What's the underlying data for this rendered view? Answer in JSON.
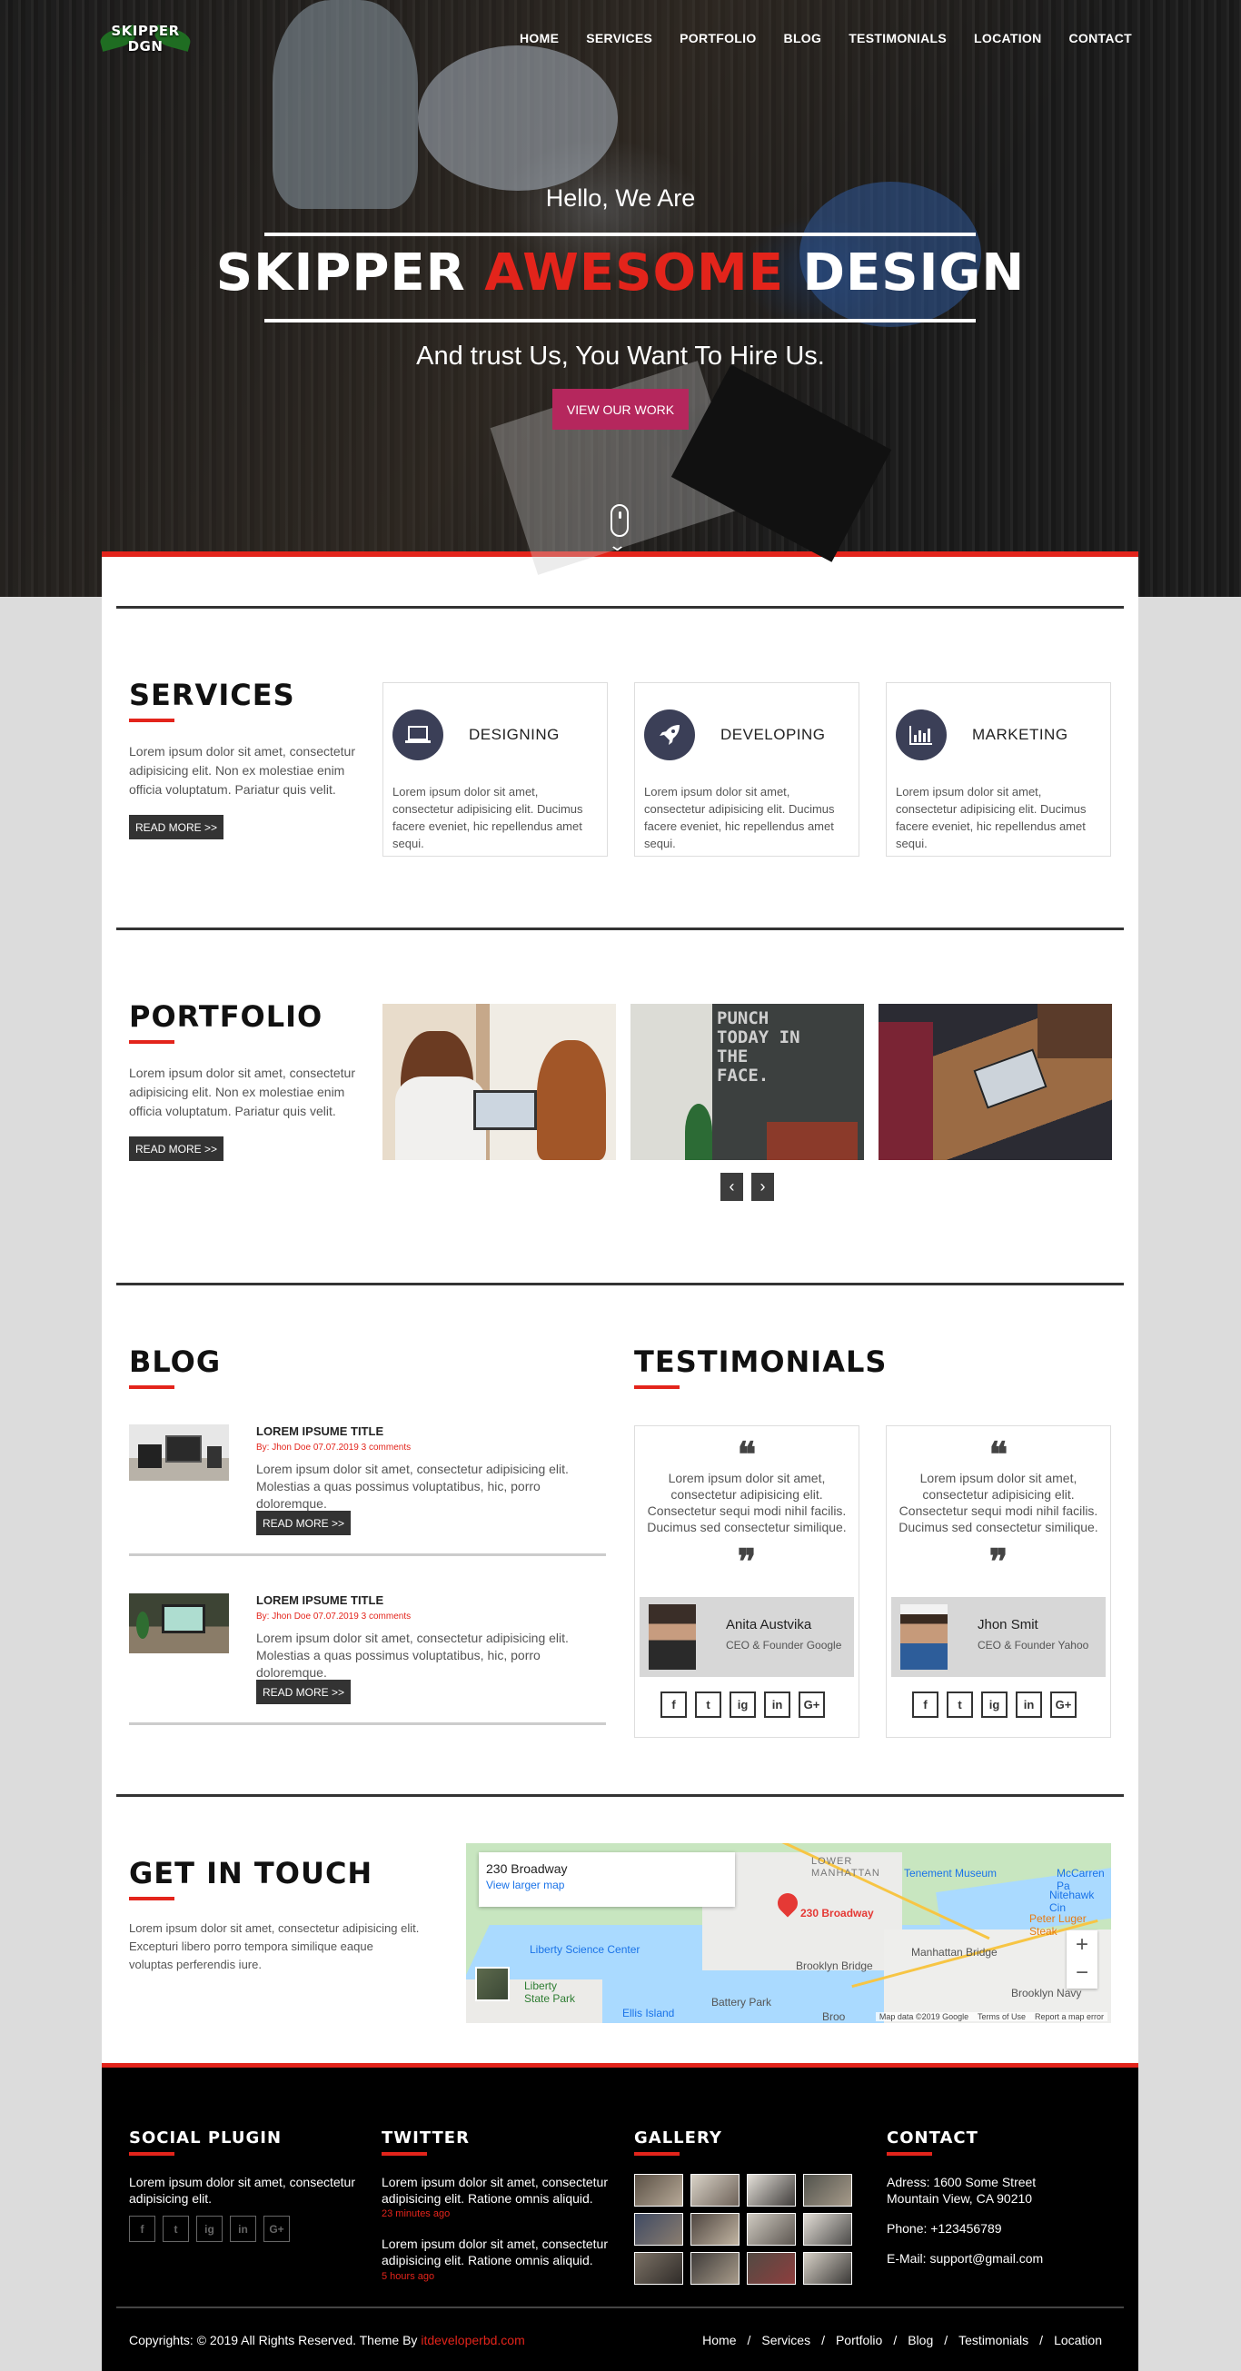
{
  "brand": {
    "logo_line1": "SKIPPER",
    "logo_line2": "DGN"
  },
  "nav": [
    "HOME",
    "SERVICES",
    "PORTFOLIO",
    "BLOG",
    "TESTIMONIALS",
    "LOCATION",
    "CONTACT"
  ],
  "hero": {
    "greeting": "Hello, We Are",
    "headline_a": "SKIPPER ",
    "headline_b": "AWESOME",
    "headline_c": " DESIGN",
    "tagline": "And trust Us, You Want To Hire Us.",
    "cta": "VIEW OUR WORK"
  },
  "services": {
    "title": "SERVICES",
    "text": "Lorem ipsum dolor sit amet, consectetur adipisicing elit. Non ex molestiae enim officia voluptatum. Pariatur quis velit.",
    "button": "READ MORE >>",
    "cards": [
      {
        "name": "DESIGNING",
        "icon": "laptop-icon",
        "text": "Lorem ipsum dolor sit amet, consectetur adipisicing elit. Ducimus facere eveniet, hic repellendus amet sequi."
      },
      {
        "name": "DEVELOPING",
        "icon": "rocket-icon",
        "text": "Lorem ipsum dolor sit amet, consectetur adipisicing elit. Ducimus facere eveniet, hic repellendus amet sequi."
      },
      {
        "name": "MARKETING",
        "icon": "bar-chart-icon",
        "text": "Lorem ipsum dolor sit amet, consectetur adipisicing elit. Ducimus facere eveniet, hic repellendus amet sequi."
      }
    ]
  },
  "portfolio": {
    "title": "PORTFOLIO",
    "text": "Lorem ipsum dolor sit amet, consectetur adipisicing elit. Non ex molestiae enim officia voluptatum. Pariatur quis velit.",
    "button": "READ MORE >>",
    "prev": "‹",
    "next": "›",
    "wall_text": "PUNCH TODAY IN THE FACE."
  },
  "blog": {
    "title": "BLOG",
    "posts": [
      {
        "title": "LOREM IPSUME TITLE",
        "meta": "By: Jhon Doe 07.07.2019 3 comments",
        "text": "Lorem ipsum dolor sit amet, consectetur adipisicing elit. Molestias a quas possimus voluptatibus, hic, porro doloremque.",
        "button": "READ MORE >>"
      },
      {
        "title": "LOREM IPSUME TITLE",
        "meta": "By: Jhon Doe 07.07.2019 3 comments",
        "text": "Lorem ipsum dolor sit amet, consectetur adipisicing elit. Molestias a quas possimus voluptatibus, hic, porro doloremque.",
        "button": "READ MORE >>"
      }
    ]
  },
  "testimonials": {
    "title": "TESTIMONIALS",
    "quote_open": "❝",
    "quote_close": "❞",
    "items": [
      {
        "text": "Lorem ipsum dolor sit amet, consectetur adipisicing elit. Consectetur sequi modi nihil facilis. Ducimus sed consectetur similique.",
        "name": "Anita Austvika",
        "role": "CEO & Founder Google"
      },
      {
        "text": "Lorem ipsum dolor sit amet, consectetur adipisicing elit. Consectetur sequi modi nihil facilis. Ducimus sed consectetur similique.",
        "name": "Jhon Smit",
        "role": "CEO & Founder Yahoo"
      }
    ],
    "social": [
      "f",
      "t",
      "ig",
      "in",
      "G+"
    ]
  },
  "contact_section": {
    "title": "GET IN TOUCH",
    "text": "Lorem ipsum dolor sit amet, consectetur adipisicing elit. Excepturi libero porro tempora similique eaque voluptas perferendis iure.",
    "map": {
      "address": "230 Broadway",
      "larger": "View larger map",
      "pin_label": "230 Broadway",
      "labels": [
        "LOWER MANHATTAN",
        "Tenement Museum",
        "McCarren Pa",
        "Nitehawk Cin",
        "Peter Luger Steak",
        "Liberty Science Center",
        "Manhattan Bridge",
        "Brooklyn Bridge",
        "Liberty State Park",
        "Ellis Island",
        "Battery Park",
        "Brooklyn Navy",
        "Broo"
      ],
      "footer": "Map data ©2019 Google    Terms of Use    Report a map error",
      "zoom_in": "+",
      "zoom_out": "−"
    }
  },
  "footer": {
    "social_title": "SOCIAL PLUGIN",
    "social_text": "Lorem ipsum dolor sit amet, consectetur adipisicing elit.",
    "social_icons": [
      "f",
      "t",
      "ig",
      "in",
      "G+"
    ],
    "twitter_title": "TWITTER",
    "tweets": [
      {
        "text": "Lorem ipsum dolor sit amet, consectetur adipisicing elit. Ratione omnis aliquid.",
        "time": "23 minutes ago"
      },
      {
        "text": "Lorem ipsum dolor sit amet, consectetur adipisicing elit. Ratione omnis aliquid.",
        "time": "5 hours ago"
      }
    ],
    "gallery_title": "GALLERY",
    "contact_title": "CONTACT",
    "address1": "Adress: 1600 Some Street",
    "address2": "Mountain View, CA 90210",
    "phone": "Phone: +123456789",
    "email": "E-Mail: support@gmail.com",
    "copyright": "Copyrights: © 2019 All Rights Reserved. Theme By ",
    "credit": "itdeveloperbd.com",
    "links": [
      "Home",
      "Services",
      "Portfolio",
      "Blog",
      "Testimonials",
      "Location"
    ],
    "link_sep": "/"
  },
  "colors": {
    "accent": "#e3241b",
    "dark": "#333333",
    "icon_bg": "#3b3f57",
    "cta": "#b5275d"
  }
}
